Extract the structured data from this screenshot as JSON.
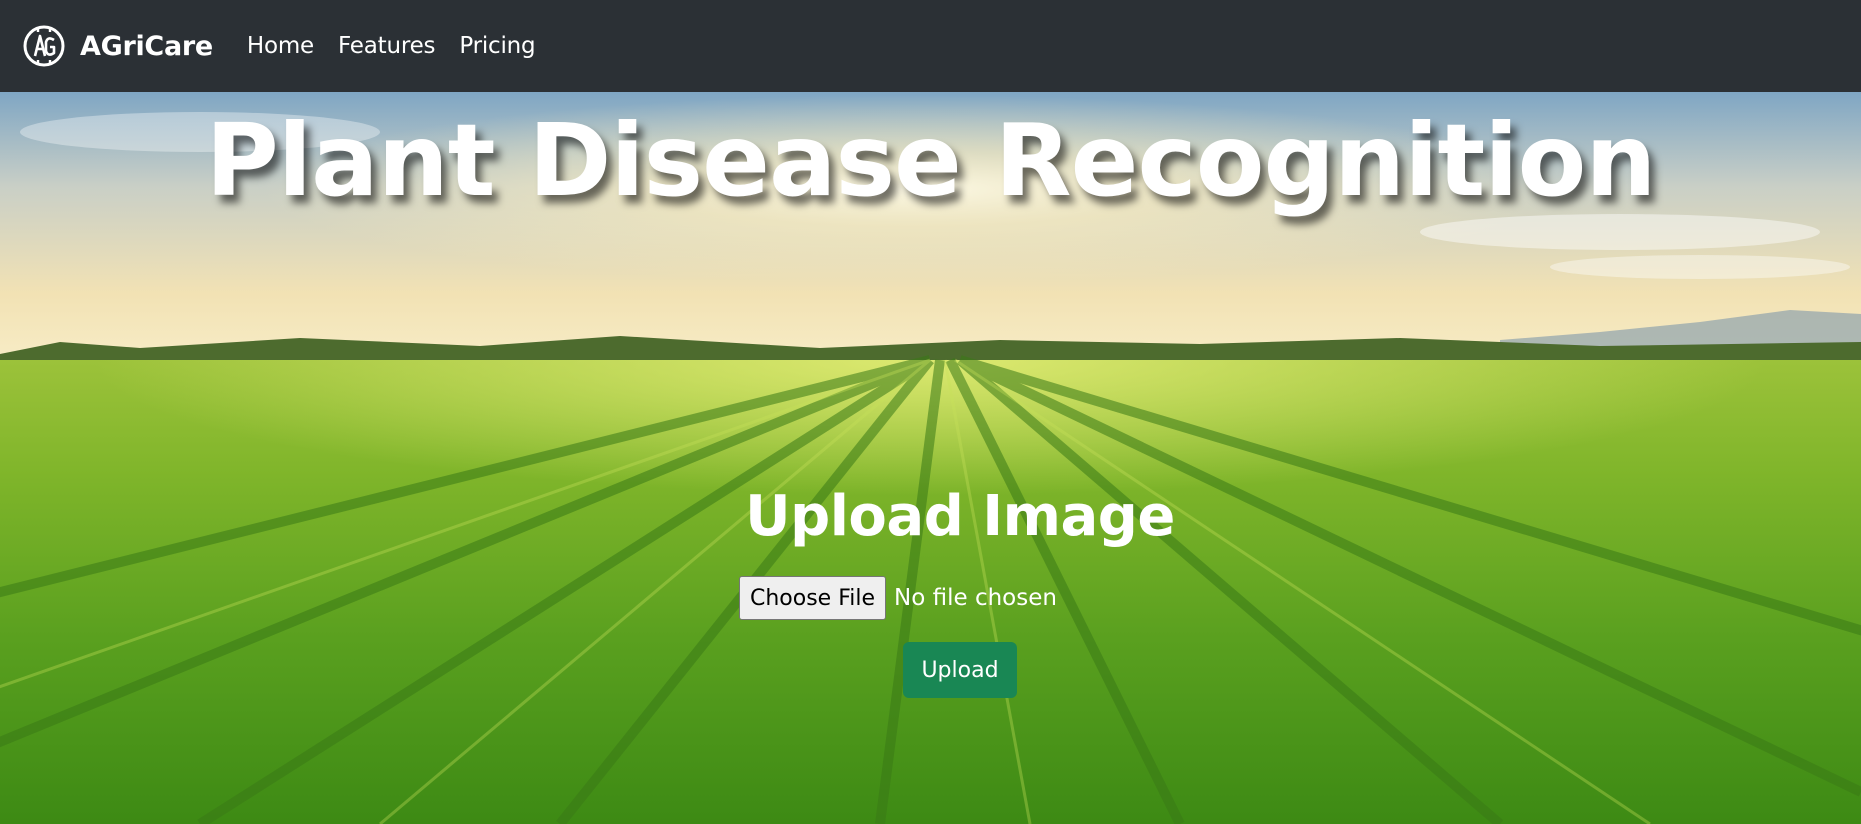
{
  "navbar": {
    "brand": "AGriCare",
    "logo_icon": "ag-monogram-logo",
    "links": [
      {
        "label": "Home"
      },
      {
        "label": "Features"
      },
      {
        "label": "Pricing"
      }
    ],
    "background": "#2b3035"
  },
  "hero": {
    "title": "Plant Disease Recognition",
    "upload_heading": "Upload Image",
    "file_input": {
      "button_label": "Choose File",
      "status": "No file chosen"
    },
    "upload_button": "Upload",
    "accent": "#198754"
  }
}
